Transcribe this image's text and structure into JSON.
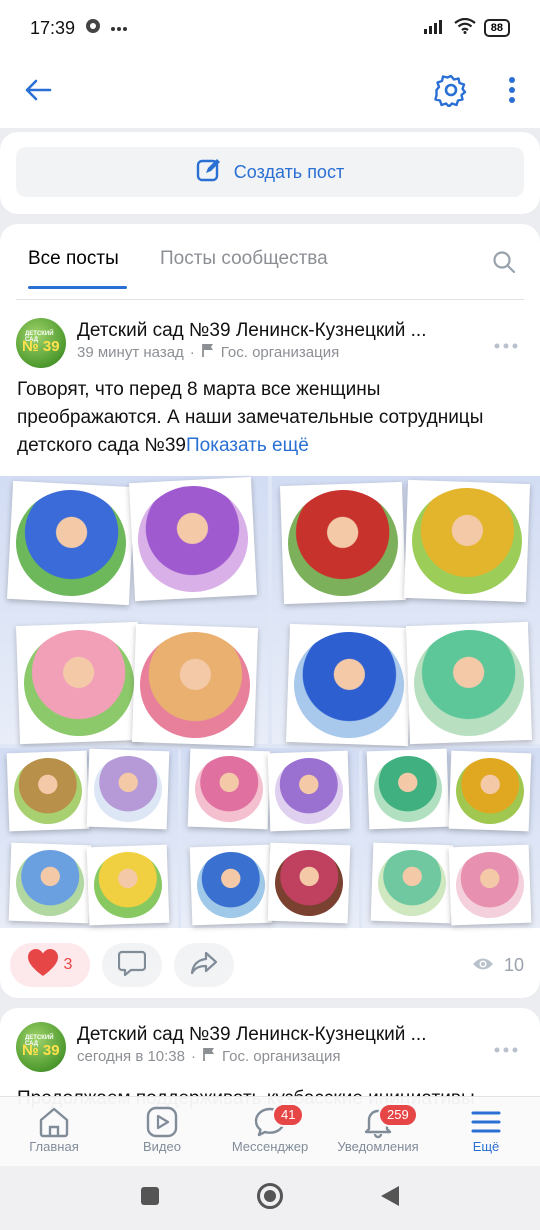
{
  "status_bar": {
    "time": "17:39",
    "battery": "88"
  },
  "create_post": {
    "label": "Создать пост"
  },
  "tabs": [
    {
      "label": "Все посты",
      "active": true
    },
    {
      "label": "Посты сообщества",
      "active": false
    }
  ],
  "post1": {
    "author": "Детский сад №39 Ленинск-Кузнецкий ...",
    "time": "39 минут назад",
    "category": "Гос. организация",
    "text": "Говорят, что перед 8 марта все женщины преображаются. А наши замечательные сотрудницы детского сада №39",
    "show_more": "Показать ещё",
    "likes": "3",
    "views": "10"
  },
  "avatar": {
    "line1": "ДЕТСКИЙ САД",
    "line2": "№ 39"
  },
  "post2": {
    "author": "Детский сад №39 Ленинск-Кузнецкий ...",
    "time": "сегодня в 10:38",
    "category": "Гос. организация",
    "text": "Продолжаем поддерживать кузбасские инициативы"
  },
  "bottom_nav": [
    {
      "label": "Главная"
    },
    {
      "label": "Видео"
    },
    {
      "label": "Мессенджер",
      "badge": "41"
    },
    {
      "label": "Уведомления",
      "badge": "259"
    },
    {
      "label": "Ещё",
      "active": true
    }
  ],
  "colors": {
    "accent": "#2a6fd3",
    "like": "#e64646",
    "muted": "#8c8f94"
  }
}
